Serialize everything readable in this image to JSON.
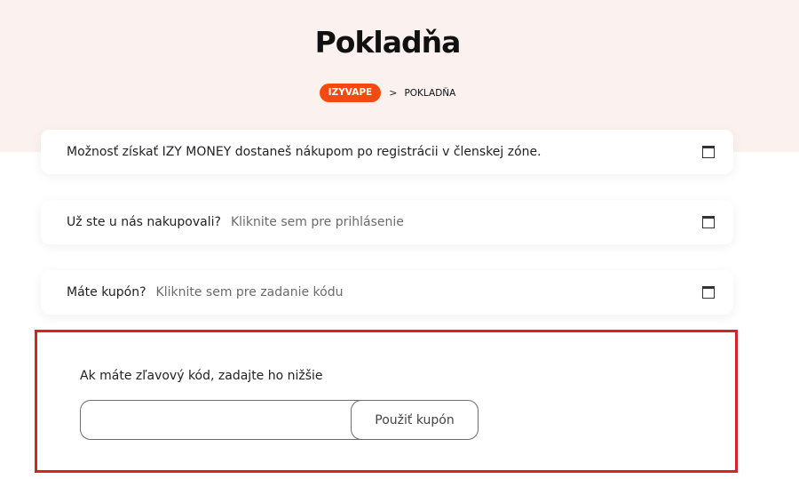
{
  "header": {
    "title": "Pokladňa",
    "breadcrumb": {
      "home": "IZYVAPE",
      "separator": ">",
      "current": "POKLADŇA"
    }
  },
  "notices": [
    {
      "text": "Možnosť získať IZY MONEY dostaneš nákupom po registrácii v členskej zóne.",
      "link": "",
      "icon": "window-icon"
    },
    {
      "text": "Už ste u nás nakupovali?",
      "link": "Kliknite sem pre prihlásenie",
      "icon": "window-icon"
    },
    {
      "text": "Máte kupón?",
      "link": "Kliknite sem pre zadanie kódu",
      "icon": "window-icon"
    }
  ],
  "coupon": {
    "label": "Ak máte zľavový kód, zadajte ho nižšie",
    "input_value": "",
    "input_placeholder": "",
    "button_label": "Použiť kupón"
  },
  "colors": {
    "accent": "#f24a10",
    "hero_background": "#fbf1ee",
    "highlight_border": "#d42424"
  }
}
